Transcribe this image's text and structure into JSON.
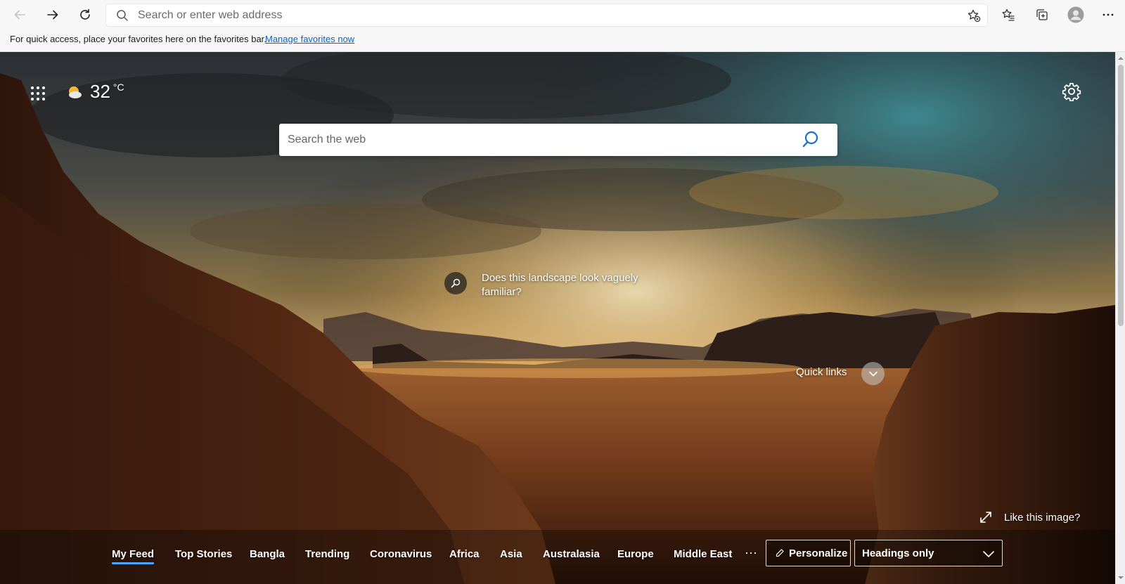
{
  "toolbar": {
    "address_placeholder": "Search or enter web address",
    "icons": [
      "back-arrow-icon",
      "forward-arrow-icon",
      "refresh-icon",
      "search-icon",
      "add-favorite-icon",
      "favorites-icon",
      "collections-icon",
      "profile-avatar-icon",
      "more-options-icon"
    ]
  },
  "favorites_bar": {
    "message": "For quick access, place your favorites here on the favorites bar.",
    "link": "Manage favorites now"
  },
  "new_tab": {
    "weather": {
      "temperature": "32",
      "unit": "°C",
      "icon": "partly-sunny-icon"
    },
    "search_placeholder": "Search the web",
    "image_caption": "Does this landscape look vaguely familiar?",
    "quick_links_label": "Quick links",
    "like_image_label": "Like this image?",
    "feed_tabs": [
      "My Feed",
      "Top Stories",
      "Bangla",
      "Trending",
      "Coronavirus",
      "Africa",
      "Asia",
      "Australasia",
      "Europe",
      "Middle East"
    ],
    "active_tab": "My Feed",
    "more_tabs": "···",
    "personalize_label": "Personalize",
    "layout_selected": "Headings only"
  },
  "colors": {
    "accent_link": "#0b61c4",
    "active_tab_underline": "#4aa3ff",
    "chrome_bg": "#f7f7f7"
  }
}
